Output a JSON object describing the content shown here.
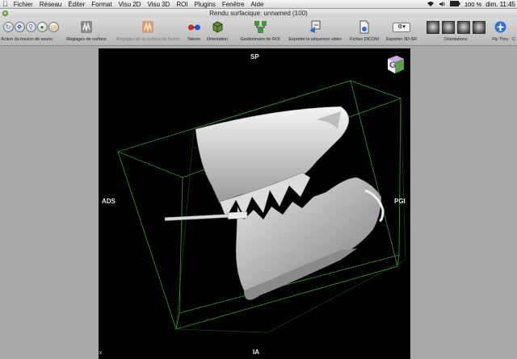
{
  "menubar": {
    "apple": "",
    "items": [
      "OsiriX",
      "Fichier",
      "Réseau",
      "Éditer",
      "Format",
      "Visu 2D",
      "Visu 3D",
      "ROI",
      "Plugins",
      "Fenêtre",
      "Aide"
    ],
    "battery": "100 %",
    "clock": "dim. 11:45"
  },
  "window": {
    "title": "Rendu surfacique: unnamed (100)"
  },
  "toolbar": {
    "mouse_label": "Action du bouton de souris",
    "surface_label": "Réglages de surface",
    "fusion_label": "Réglages de la surface de fusion",
    "stereo_label": "Stéréo",
    "orientation_label": "Orientation",
    "roi_manager_label": "Gestionnaire de ROI",
    "export_video_label": "Exporter la séquence vidéo",
    "dicom_label": "Fichier DICOM",
    "export_sr_label": "Exporter 3D-SR",
    "orientations_label": "Orientations",
    "flythru_label": "Fly Thru",
    "last_label": "C"
  },
  "viewport": {
    "top": "SP",
    "bottom": "IA",
    "left": "ADS",
    "right": "PGI",
    "corner": "x",
    "cube_letter": "G"
  }
}
